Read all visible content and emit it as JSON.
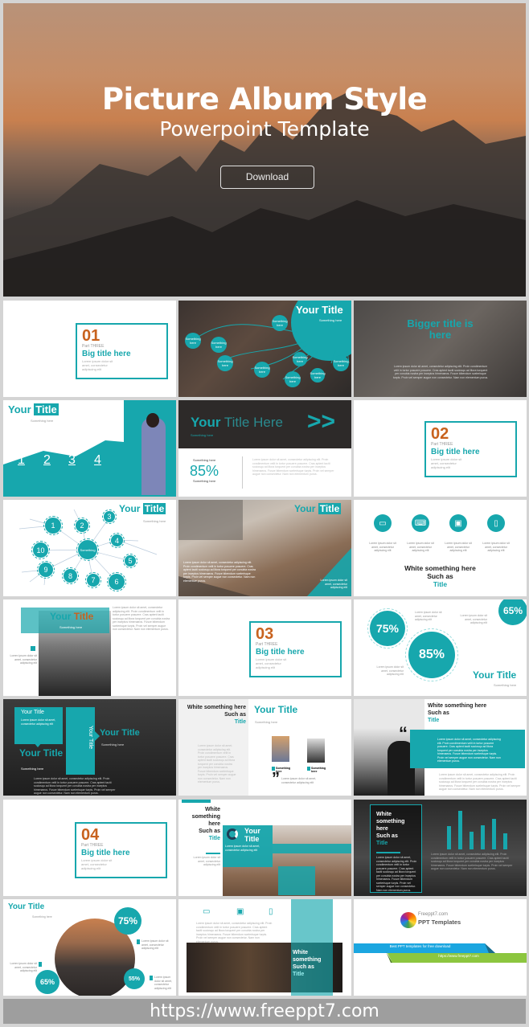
{
  "hero": {
    "title": "Picture Album Style",
    "subtitle": "Powerpoint Template",
    "download_label": "Download"
  },
  "common": {
    "lorem_short": "Lorem ipsum dolor sit amet, consectetur adipiscing elit",
    "lorem_long": "Lorem ipsum dolor sit amet, consectetur adipiscing elit. Proin condimentum velit in tortor posuere posuere. Cras aptent taciti sociosqu ad litora torquent per conubia nostra per inceptos himenaeos. Fusce bibendum scelerisque turpis. Proin vel semper augue non consectetur. Nam non elementum purus.",
    "something_here": "Something here",
    "something": "Something",
    "your": "Your",
    "title_word": "Title",
    "your_title": "Your Title"
  },
  "slides": {
    "s01": {
      "num": "01",
      "part": "Part THREE",
      "title": "Big title here"
    },
    "s02": {
      "title": "Your Title",
      "subtitle": "Something here",
      "bubble_label": "Something here"
    },
    "s03": {
      "title": "Bigger title is here"
    },
    "s04": {
      "title_a": "Your",
      "title_b": "Title",
      "subtitle": "Something here",
      "steps": [
        "1",
        "2",
        "3",
        "4"
      ]
    },
    "s05": {
      "title_a": "Your",
      "title_b": "Title Here",
      "subtitle": "Something here",
      "stat_top": "Something here",
      "stat": "85%",
      "stat_bottom": "Something here"
    },
    "s06": {
      "num": "02",
      "part": "Part THREE",
      "title": "Big title here"
    },
    "s07": {
      "title_a": "Your",
      "title_b": "Title",
      "subtitle": "Something here",
      "hub": "Something",
      "nodes": [
        "1",
        "2",
        "3",
        "4",
        "5",
        "6",
        "7",
        "8",
        "9",
        "10"
      ]
    },
    "s08": {
      "title_a": "Your",
      "title_b": "Title"
    },
    "s09": {
      "line1": "White something here",
      "line2": "Such as",
      "line3": "Title",
      "icons": [
        "monitor-chart-icon",
        "laptop-icon",
        "desktop-icon",
        "mobile-icon"
      ]
    },
    "s10": {
      "title_a": "Your",
      "title_b": "Title",
      "subtitle": "Something here"
    },
    "s11": {
      "num": "03",
      "part": "Part THREE",
      "title": "Big title here"
    },
    "s12": {
      "stats": [
        "75%",
        "85%",
        "65%"
      ],
      "title": "Your Title",
      "subtitle": "Something here"
    },
    "s13": {
      "box_title": "Your Title",
      "vertical_title": "Your Title",
      "big_title": "Your Title",
      "right_title": "Your Title",
      "subtitle": "Something here"
    },
    "s14": {
      "line1": "White something here",
      "line2": "Such as",
      "line3": "Title",
      "title": "Your Title",
      "subtitle": "Something here",
      "cap1": "Something here",
      "cap2": "Something here"
    },
    "s15": {
      "line1": "White something here",
      "line2": "Such as",
      "line3": "Title"
    },
    "s16": {
      "num": "04",
      "part": "Part THREE",
      "title": "Big title here"
    },
    "s17": {
      "line1": "White",
      "line2": "something",
      "line3": "here",
      "line4": "Such as",
      "line5": "Title",
      "title_a": "Your",
      "title_b": "Title"
    },
    "s18": {
      "line1": "White",
      "line2": "something",
      "line3": "here",
      "line4": "Such as",
      "line5": "Title",
      "bars": [
        0.6,
        1.0,
        0.45,
        0.62,
        0.8,
        0.42
      ]
    },
    "s19": {
      "title": "Your Title",
      "subtitle": "Something here",
      "stats": [
        "75%",
        "65%",
        "55%"
      ]
    },
    "s20": {
      "line1": "White",
      "line2": "something",
      "line3": "Such as",
      "line4": "Title"
    },
    "s21": {
      "brand1": "Freeppt7.com",
      "brand2": "PPT Templates",
      "banner": "Best PPT templates for free download",
      "url": "https://www.freeppt7.com"
    }
  },
  "footer": {
    "url": "https://www.freeppt7.com"
  },
  "colors": {
    "teal": "#17a7ad",
    "orange": "#c8621e",
    "blue": "#1ba6e0",
    "green": "#8cc63f"
  }
}
